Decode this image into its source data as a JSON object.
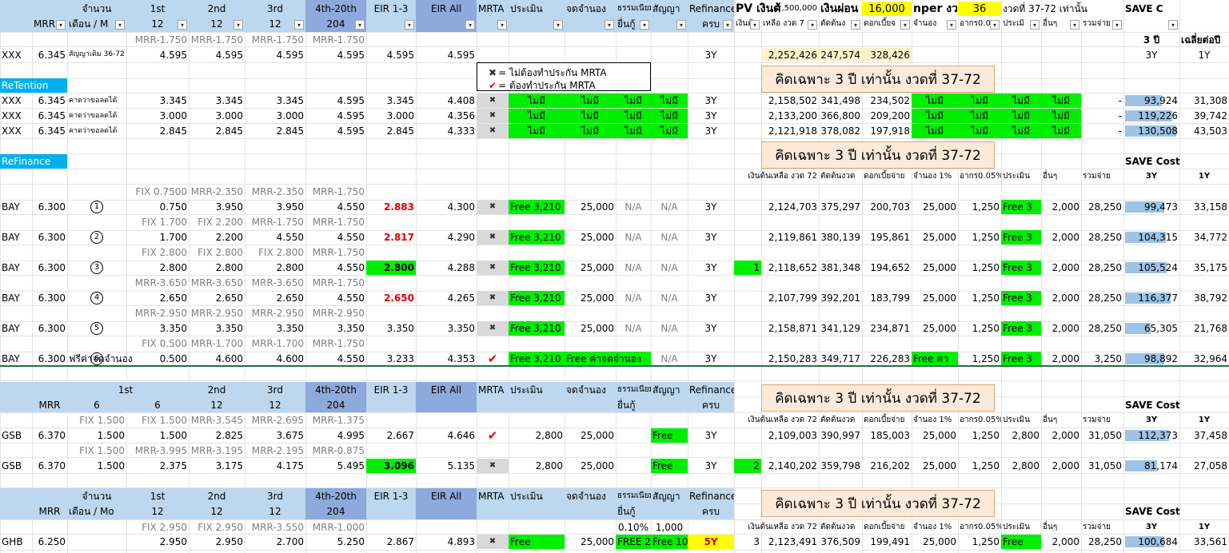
{
  "header": {
    "row1": {
      "jamnuan": "จำนวน",
      "first": "1st",
      "second": "2nd",
      "third": "3rd",
      "fourth": "4th-20th",
      "eir13": "EIR 1-3",
      "eirall": "EIR All",
      "mrta": "MRTA",
      "pramern": "ประเมิน",
      "jod": "จดจำนอง",
      "fee": "ธรรมเนียม",
      "sanya": "สัญญา",
      "refinance": "Refinance",
      "pv_label": "PV เงินต้",
      "pv_value": "2,500,000",
      "pon_label": "เงินผ่อน",
      "pon_value": "16,000",
      "nper_label": "nper งว",
      "nper_value": "36",
      "period_label": "งวดที่ 37-72 เท่านั้น",
      "save": "SAVE C"
    },
    "row2": {
      "mrr": "MRR",
      "months": "เดือน / M",
      "m1": "12",
      "m2": "12",
      "m3": "12",
      "m4": "204",
      "fee2": "ยื่นกู้",
      "crob": "ครบ",
      "k1": "เงินต้",
      "k2": "เหลือ งวด 7",
      "k3": "ตัดต้นง",
      "k4": "ดอกเบี้ยจ",
      "k5": "จำนอง",
      "k6": "อากร0.0",
      "k7": "ประเมิ",
      "k8": "อื่นๆ",
      "k9": "รวมจ่าย"
    }
  },
  "xxx_section": {
    "mrr_row": [
      "MRR-1.750",
      "MRR-1.750",
      "MRR-1.750",
      "MRR-1.750"
    ],
    "save_years_header": "3 ปี",
    "save_avg_header": "เฉลี่ยต่อปี",
    "base": {
      "bank": "XXX",
      "mrr": "6.345",
      "note": "สัญญาเดิม 36-72",
      "rates": [
        "4.595",
        "4.595",
        "4.595",
        "4.595",
        "4.595",
        "4.595"
      ],
      "refi": "3Y",
      "balance": "2,252,426",
      "principal": "247,574",
      "interest": "328,426",
      "s3": "3Y",
      "s1": "1Y"
    }
  },
  "legend": {
    "no_mrta": "= ไม่ต้องทำประกัน MRTA",
    "yes_mrta": "= ต้องทำประกัน MRTA"
  },
  "notes": {
    "only3y": "คิดเฉพาะ 3 ปี เท่านั้น งวดที่ 37-72"
  },
  "retention": {
    "title": "ReTention",
    "rows": [
      {
        "bank": "XXX",
        "mrr": "6.345",
        "note": "คาดว่าขอลดได้",
        "r": [
          "3.345",
          "3.345",
          "3.345",
          "4.595"
        ],
        "eir13": "3.345",
        "eirall": "4.408",
        "p": "ไม่มี",
        "j": "ไม่มี",
        "f": "ไม่มี",
        "s": "ไม่มี",
        "refi": "3Y",
        "bal": "2,158,502",
        "pr": "341,498",
        "int": "234,502",
        "k5": "ไม่มี",
        "k6": "ไม่มี",
        "k7": "ไม่มี",
        "k8": "ไม่มี",
        "tot": "-",
        "s3": "93,924",
        "s1": "31,308",
        "bar": 0.72
      },
      {
        "bank": "XXX",
        "mrr": "6.345",
        "note": "คาดว่าขอลดได้",
        "r": [
          "3.000",
          "3.000",
          "3.000",
          "4.595"
        ],
        "eir13": "3.000",
        "eirall": "4.356",
        "p": "ไม่มี",
        "j": "ไม่มี",
        "f": "ไม่มี",
        "s": "ไม่มี",
        "refi": "3Y",
        "bal": "2,133,200",
        "pr": "366,800",
        "int": "209,200",
        "k5": "ไม่มี",
        "k6": "ไม่มี",
        "k7": "ไม่มี",
        "k8": "ไม่มี",
        "tot": "-",
        "s3": "119,226",
        "s1": "39,742",
        "bar": 0.92
      },
      {
        "bank": "XXX",
        "mrr": "6.345",
        "note": "คาดว่าขอลดได้",
        "r": [
          "2.845",
          "2.845",
          "2.845",
          "4.595"
        ],
        "eir13": "2.845",
        "eirall": "4.333",
        "p": "ไม่มี",
        "j": "ไม่มี",
        "f": "ไม่มี",
        "s": "ไม่มี",
        "refi": "3Y",
        "bal": "2,121,918",
        "pr": "378,082",
        "int": "197,918",
        "k5": "ไม่มี",
        "k6": "ไม่มี",
        "k7": "ไม่มี",
        "k8": "ไม่มี",
        "tot": "-",
        "s3": "130,508",
        "s1": "43,503",
        "bar": 1.0
      }
    ]
  },
  "refinance": {
    "title": "ReFinance",
    "save_header": "SAVE Cost",
    "sub_headers": [
      "เงินต้นเหลือ งวด 72",
      "ตัดต้นงวด",
      "ดอกเบี้ยจ่าย",
      "จำนอง 1%",
      "อากร0.05%",
      "ประเมิน",
      "อื่นๆ",
      "รวมจ่าย",
      "3Y",
      "1Y"
    ],
    "rows": [
      {
        "fix": [
          "FIX 0.7500",
          "MRR-2.350",
          "MRR-2.350",
          "MRR-1.750"
        ],
        "bank": "BAY",
        "mrr": "6.300",
        "num": "1",
        "r": [
          "0.750",
          "3.950",
          "3.950",
          "4.550"
        ],
        "eir13": "2.883",
        "eir13_style": "red",
        "eirall": "4.300",
        "mrta": "x",
        "p": "Free 3,210",
        "j": "25,000",
        "f": "N/A",
        "s": "N/A",
        "refi": "3Y",
        "rank": "",
        "bal": "2,124,703",
        "pr": "375,297",
        "int": "200,703",
        "k5": "25,000",
        "k6": "1,250",
        "k7": "Free 3",
        "k8": "2,000",
        "tot": "28,250",
        "s3": "99,473",
        "s1": "33,158",
        "bar": 0.76
      },
      {
        "fix": [
          "FIX 1.700",
          "FIX 2.200",
          "MRR-1.750",
          "MRR-1.750"
        ],
        "bank": "BAY",
        "mrr": "6.300",
        "num": "2",
        "r": [
          "1.700",
          "2.200",
          "4.550",
          "4.550"
        ],
        "eir13": "2.817",
        "eir13_style": "red",
        "eirall": "4.290",
        "mrta": "x",
        "p": "Free 3,210",
        "j": "25,000",
        "f": "N/A",
        "s": "N/A",
        "refi": "3Y",
        "rank": "",
        "bal": "2,119,861",
        "pr": "380,139",
        "int": "195,861",
        "k5": "25,000",
        "k6": "1,250",
        "k7": "Free 3",
        "k8": "2,000",
        "tot": "28,250",
        "s3": "104,315",
        "s1": "34,772",
        "bar": 0.8
      },
      {
        "fix": [
          "FIX 2.800",
          "FIX 2.800",
          "FIX 2.800",
          "MRR-1.750"
        ],
        "bank": "BAY",
        "mrr": "6.300",
        "num": "3",
        "r": [
          "2.800",
          "2.800",
          "2.800",
          "4.550"
        ],
        "eir13": "2.800",
        "eir13_style": "green",
        "eirall": "4.288",
        "mrta": "x",
        "p": "Free 3,210",
        "j": "25,000",
        "f": "N/A",
        "s": "N/A",
        "refi": "3Y",
        "rank": "1",
        "bal": "2,118,652",
        "pr": "381,348",
        "int": "194,652",
        "k5": "25,000",
        "k6": "1,250",
        "k7": "Free 3",
        "k8": "2,000",
        "tot": "28,250",
        "s3": "105,524",
        "s1": "35,175",
        "bar": 0.81
      },
      {
        "fix": [
          "MRR-3.650",
          "MRR-3.650",
          "MRR-3.650",
          "MRR-1.750"
        ],
        "bank": "BAY",
        "mrr": "6.300",
        "num": "4",
        "r": [
          "2.650",
          "2.650",
          "2.650",
          "4.550"
        ],
        "eir13": "2.650",
        "eir13_style": "red",
        "eirall": "4.265",
        "mrta": "x",
        "p": "Free 3,210",
        "j": "25,000",
        "f": "N/A",
        "s": "N/A",
        "refi": "3Y",
        "rank": "",
        "bal": "2,107,799",
        "pr": "392,201",
        "int": "183,799",
        "k5": "25,000",
        "k6": "1,250",
        "k7": "Free 3",
        "k8": "2,000",
        "tot": "28,250",
        "s3": "116,377",
        "s1": "38,792",
        "bar": 0.89
      },
      {
        "fix": [
          "MRR-2.950",
          "MRR-2.950",
          "MRR-2.950",
          "MRR-2.950"
        ],
        "bank": "BAY",
        "mrr": "6.300",
        "num": "5",
        "r": [
          "3.350",
          "3.350",
          "3.350",
          "3.350"
        ],
        "eir13": "3.350",
        "eir13_style": "",
        "eirall": "3.350",
        "mrta": "x",
        "p": "Free 3,210",
        "j": "25,000",
        "f": "N/A",
        "s": "N/A",
        "refi": "3Y",
        "rank": "",
        "bal": "2,158,871",
        "pr": "341,129",
        "int": "234,871",
        "k5": "25,000",
        "k6": "1,250",
        "k7": "Free 3",
        "k8": "2,000",
        "tot": "28,250",
        "s3": "65,305",
        "s1": "21,768",
        "bar": 0.5
      },
      {
        "fix": [
          "FIX 0.500",
          "MRR-1.700",
          "MRR-1.700",
          "MRR-1.750"
        ],
        "bank": "BAY",
        "mrr": "6.300",
        "num": "6",
        "r": [
          "0.500",
          "4.600",
          "4.600",
          "4.550"
        ],
        "eir13": "3.233",
        "eir13_style": "",
        "eirall": "4.353",
        "mrta": "check",
        "p": "Free 3,210",
        "j": "Free ค่าจดจำนอง",
        "f": "N/A",
        "s": "N/A",
        "refi": "3Y",
        "rank": "",
        "bal": "2,150,283",
        "pr": "349,717",
        "int": "226,283",
        "k5": "Free ค่า",
        "k6": "1,250",
        "k7": "Free 3",
        "k8": "2,000",
        "tot": "3,250",
        "s3": "98,892",
        "s1": "32,964",
        "bar": 0.76
      }
    ],
    "free_note": "ฟรีค่าจดจำนอง"
  },
  "gsb": {
    "header": {
      "mrr": "MRR",
      "first": "1st",
      "m6a": "6",
      "m6b": "6",
      "second": "2nd",
      "m2": "12",
      "third": "3rd",
      "m3": "12",
      "fourth": "4th-20th",
      "m4": "204",
      "eir13": "EIR 1-3",
      "eirall": "EIR All",
      "mrta": "MRTA",
      "pramern": "ประเมิน",
      "jod": "จดจำนอง",
      "fee": "ธรรมเนียม",
      "fee2": "ยื่นกู้",
      "sanya": "สัญญา",
      "refinance": "Refinance",
      "crob": "ครบ"
    },
    "save_header": "SAVE Cost",
    "sub_headers": [
      "เงินต้นเหลือ งวด 72",
      "ตัดต้นงวด",
      "ดอกเบี้ยจ่าย",
      "จำนอง 1%",
      "อากร0.05%",
      "ประเมิน",
      "อื่นๆ",
      "รวมจ่าย",
      "3Y",
      "1Y"
    ],
    "rows": [
      {
        "fix": [
          "FIX 1.500",
          "FIX 1.500",
          "MRR-3.545",
          "MRR-2.695",
          "MRR-1.375"
        ],
        "bank": "GSB",
        "mrr": "6.370",
        "r": [
          "1.500",
          "1.500",
          "2.825",
          "3.675",
          "4.995"
        ],
        "eir13": "2.667",
        "eir13_style": "",
        "eirall": "4.646",
        "mrta": "check",
        "p": "2,800",
        "j": "25,000",
        "f": "",
        "s": "Free",
        "refi": "3Y",
        "rank": "",
        "bal": "2,109,003",
        "pr": "390,997",
        "int": "185,003",
        "k5": "25,000",
        "k6": "1,250",
        "k7": "2,800",
        "k8": "2,000",
        "tot": "31,050",
        "s3": "112,373",
        "s1": "37,458",
        "bar": 0.86
      },
      {
        "fix": [
          "FIX 1.500",
          "MRR-3.995",
          "MRR-3.195",
          "MRR-2.195",
          "MRR-0.875"
        ],
        "bank": "GSB",
        "mrr": "6.370",
        "r": [
          "1.500",
          "2.375",
          "3.175",
          "4.175",
          "5.495"
        ],
        "eir13": "3.096",
        "eir13_style": "green",
        "eirall": "5.135",
        "mrta": "x",
        "p": "2,800",
        "j": "25,000",
        "f": "",
        "s": "Free",
        "refi": "3Y",
        "rank": "2",
        "bal": "2,140,202",
        "pr": "359,798",
        "int": "216,202",
        "k5": "25,000",
        "k6": "1,250",
        "k7": "2,800",
        "k8": "2,000",
        "tot": "31,050",
        "s3": "81,174",
        "s1": "27,058",
        "bar": 0.62
      }
    ]
  },
  "ghb": {
    "header": {
      "jamnuan": "จำนวน",
      "mrr": "MRR",
      "months": "เดือน / Mo",
      "first": "1st",
      "m1": "12",
      "second": "2nd",
      "m2": "12",
      "third": "3rd",
      "m3": "12",
      "fourth": "4th-20th",
      "m4": "204",
      "eir13": "EIR 1-3",
      "eirall": "EIR All",
      "mrta": "MRTA",
      "pramern": "ประเมิน",
      "jod": "จดจำนอง",
      "fee": "ธรรมเนียม",
      "fee2": "ยื่นกู้",
      "sanya": "สัญญา",
      "refinance": "Refinance",
      "crob": "ครบ"
    },
    "save_header": "SAVE Cost",
    "sub_headers": [
      "เงินต้นเหลือ งวด 72",
      "ตัดต้นงวด",
      "ดอกเบี้ยจ่าย",
      "จำนอง 1%",
      "อากร0.05%",
      "ประเมิน",
      "อื่นๆ",
      "รวมจ่าย",
      "3Y",
      "1Y"
    ],
    "fix": [
      "FIX 2.950",
      "FIX 2.950",
      "MRR-3.550",
      "MRR-1.000"
    ],
    "fee_pct": "0.10%",
    "fee_val": "1,000",
    "row": {
      "bank": "GHB",
      "mrr": "6.250",
      "r": [
        "2.950",
        "2.950",
        "2.700",
        "5.250"
      ],
      "eir13": "2.867",
      "eirall": "4.893",
      "mrta": "x",
      "p": "Free",
      "j": "25,000",
      "f": "FREE 2,5",
      "s": "Free 10",
      "refi": "5Y",
      "rank": "3",
      "bal": "2,123,491",
      "pr": "376,509",
      "int": "199,491",
      "k5": "25,000",
      "k6": "1,250",
      "k7": "Free",
      "k8": "2,000",
      "tot": "28,250",
      "s3": "100,684",
      "s1": "33,561",
      "bar": 0.77
    }
  },
  "colors": {
    "green": "#00ee00",
    "yellow": "#ffff00",
    "headerBlue": "#bdd7ee",
    "headerDark": "#8ea9db",
    "sectionBlue": "#00b0f0",
    "noteFill": "#fdeada",
    "bar": "#9dc3e6",
    "red": "#e00000"
  }
}
